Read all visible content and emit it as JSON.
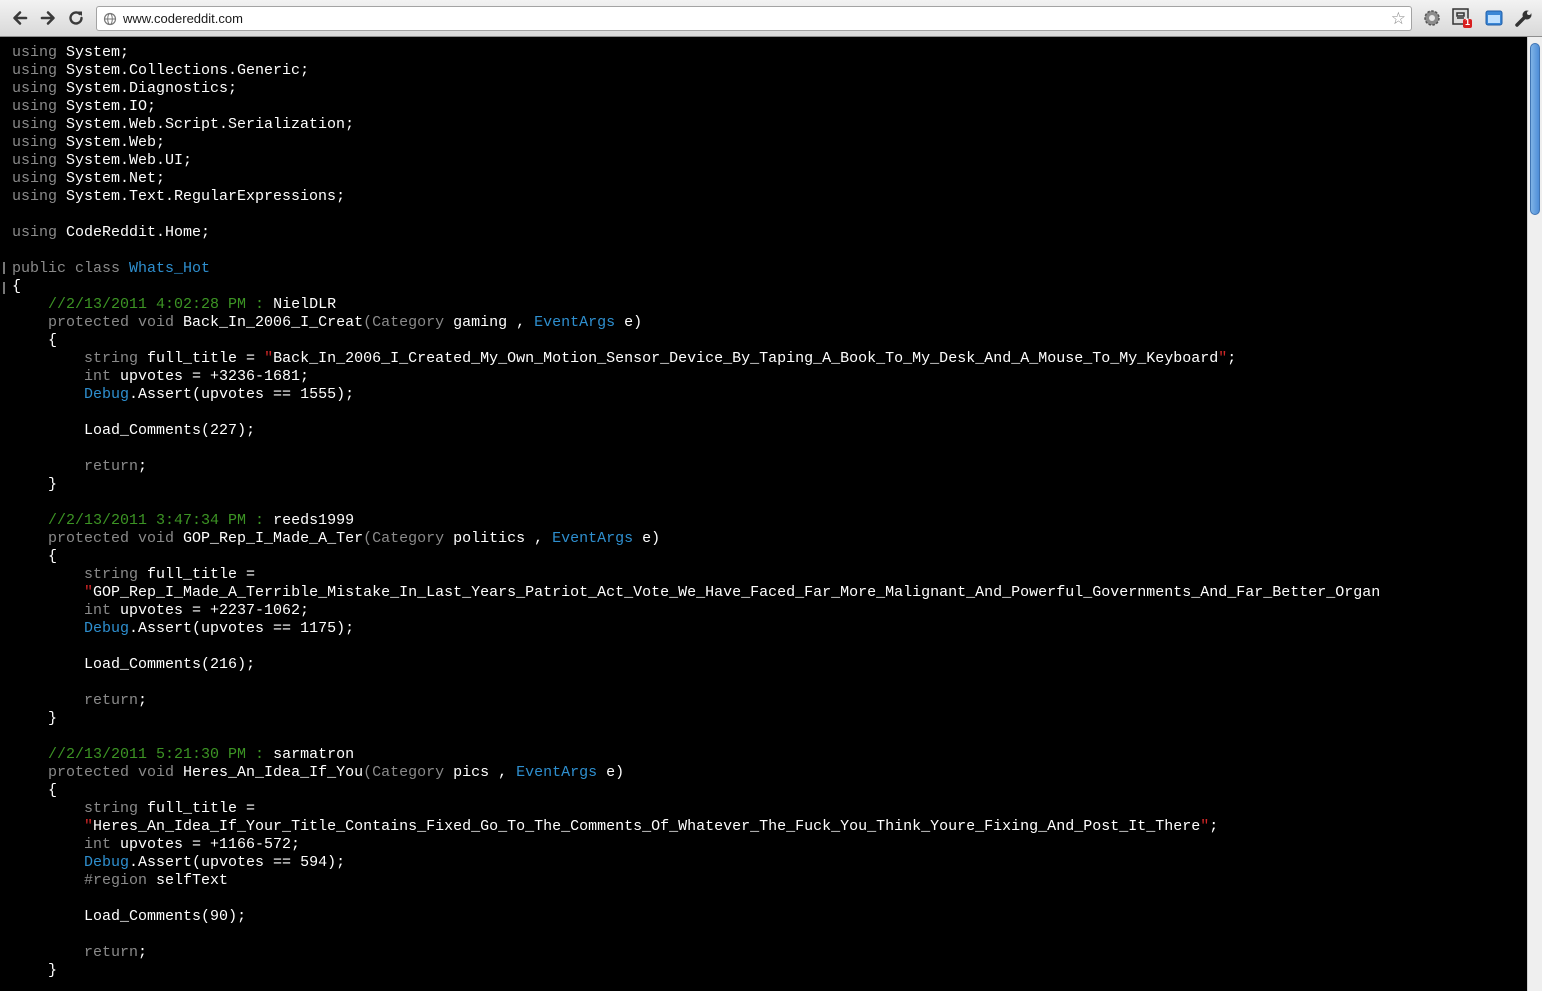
{
  "browser": {
    "url": "www.codereddit.com",
    "extension_badge": "1"
  },
  "code": {
    "usings": [
      "System",
      "System.Collections.Generic",
      "System.Diagnostics",
      "System.IO",
      "System.Web.Script.Serialization",
      "System.Web",
      "System.Web.UI",
      "System.Net",
      "System.Text.RegularExpressions"
    ],
    "extra_using": "CodeReddit.Home",
    "class_name": "Whats_Hot",
    "posts": [
      {
        "timestamp": "//2/13/2011 4:02:28 PM :",
        "author": "NielDLR",
        "method": "Back_In_2006_I_Creat",
        "category": "gaming",
        "title": "Back_In_2006_I_Created_My_Own_Motion_Sensor_Device_By_Taping_A_Book_To_My_Desk_And_A_Mouse_To_My_Keyboard",
        "upvotes_expr": "+3236-1681;",
        "assert_value": "1555",
        "comments": "227",
        "title_wrapped": false,
        "region": ""
      },
      {
        "timestamp": "//2/13/2011 3:47:34 PM :",
        "author": "reeds1999",
        "method": "GOP_Rep_I_Made_A_Ter",
        "category": "politics",
        "title": "GOP_Rep_I_Made_A_Terrible_Mistake_In_Last_Years_Patriot_Act_Vote_We_Have_Faced_Far_More_Malignant_And_Powerful_Governments_And_Far_Better_Organ",
        "upvotes_expr": "+2237-1062;",
        "assert_value": "1175",
        "comments": "216",
        "title_wrapped": true,
        "region": ""
      },
      {
        "timestamp": "//2/13/2011 5:21:30 PM :",
        "author": "sarmatron",
        "method": "Heres_An_Idea_If_You",
        "category": "pics",
        "title": "Heres_An_Idea_If_Your_Title_Contains_Fixed_Go_To_The_Comments_Of_Whatever_The_Fuck_You_Think_Youre_Fixing_And_Post_It_There",
        "upvotes_expr": "+1166-572;",
        "assert_value": "594",
        "comments": "90",
        "title_wrapped": true,
        "region": "selfText"
      }
    ]
  }
}
